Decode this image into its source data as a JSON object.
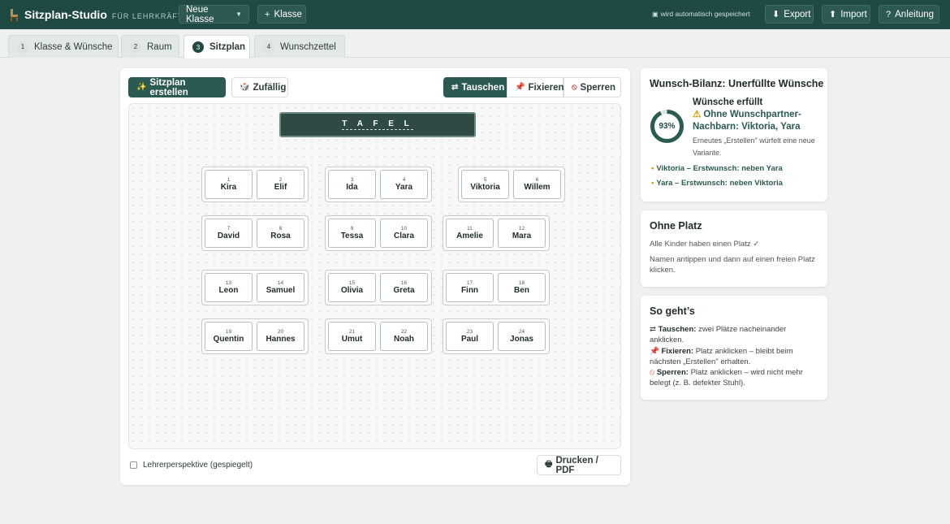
{
  "app": {
    "title": "Sitzplan-Studio",
    "subtitle": "FÜR LEHRKRÄFTE",
    "class_select": "Neue Klasse",
    "add_class": "Klasse",
    "autosave": "wird automatisch gespeichert",
    "export": "Export",
    "import": "Import",
    "guide": "Anleitung"
  },
  "tabs": [
    {
      "num": "1",
      "label": "Klasse & Wünsche"
    },
    {
      "num": "2",
      "label": "Raum"
    },
    {
      "num": "3",
      "label": "Sitzplan"
    },
    {
      "num": "4",
      "label": "Wunschzettel"
    }
  ],
  "toolbar": {
    "create": "Sitzplan erstellen",
    "random": "Zufällig",
    "swap": "Tauschen",
    "fix": "Fixieren",
    "block": "Sperren"
  },
  "room": {
    "board": "T A F E L",
    "seats": [
      {
        "n": "1",
        "name": "Kira"
      },
      {
        "n": "2",
        "name": "Elif"
      },
      {
        "n": "3",
        "name": "Ida"
      },
      {
        "n": "4",
        "name": "Yara"
      },
      {
        "n": "5",
        "name": "Viktoria"
      },
      {
        "n": "6",
        "name": "Willem"
      },
      {
        "n": "7",
        "name": "David"
      },
      {
        "n": "8",
        "name": "Rosa"
      },
      {
        "n": "9",
        "name": "Tessa"
      },
      {
        "n": "10",
        "name": "Clara"
      },
      {
        "n": "11",
        "name": "Amelie"
      },
      {
        "n": "12",
        "name": "Mara"
      },
      {
        "n": "13",
        "name": "Leon"
      },
      {
        "n": "14",
        "name": "Samuel"
      },
      {
        "n": "15",
        "name": "Olivia"
      },
      {
        "n": "16",
        "name": "Greta"
      },
      {
        "n": "17",
        "name": "Finn"
      },
      {
        "n": "18",
        "name": "Ben"
      },
      {
        "n": "19",
        "name": "Quentin"
      },
      {
        "n": "20",
        "name": "Hannes"
      },
      {
        "n": "21",
        "name": "Umut"
      },
      {
        "n": "22",
        "name": "Noah"
      },
      {
        "n": "23",
        "name": "Paul"
      },
      {
        "n": "24",
        "name": "Jonas"
      }
    ],
    "perspective": "Lehrerperspektive (gespiegelt)",
    "print": "Drucken / PDF"
  },
  "wishes": {
    "title": "Wunsch-Bilanz: Unerfüllte Wünsche",
    "percent": "93%",
    "percent_value": 0.93,
    "fulfilled": "Wünsche erfüllt",
    "warning": "Ohne Wunschpartner-Nachbarn: Viktoria, Yara",
    "warning_sub": "Erneutes „Erstellen\" würfelt eine neue Variante.",
    "items": [
      "Viktoria – Erstwunsch: neben Yara",
      "Yara – Erstwunsch: neben Viktoria"
    ]
  },
  "noseat": {
    "title": "Ohne Platz",
    "status": "Alle Kinder haben einen Platz ✓",
    "hint": "Namen antippen und dann auf einen freien Platz klicken."
  },
  "howto": {
    "title": "So geht’s",
    "swap_label": "Tauschen:",
    "swap_text": "zwei Plätze nacheinander anklicken.",
    "fix_label": "Fixieren:",
    "fix_text": "Platz anklicken – bleibt beim nächsten „Erstellen\" erhalten.",
    "block_label": "Sperren:",
    "block_text": "Platz anklicken – wird nicht mehr belegt (z. B. defekter Stuhl)."
  },
  "colors": {
    "topbar": "#1f4a43",
    "accent": "#2a5a51",
    "warning": "#d49a12"
  }
}
